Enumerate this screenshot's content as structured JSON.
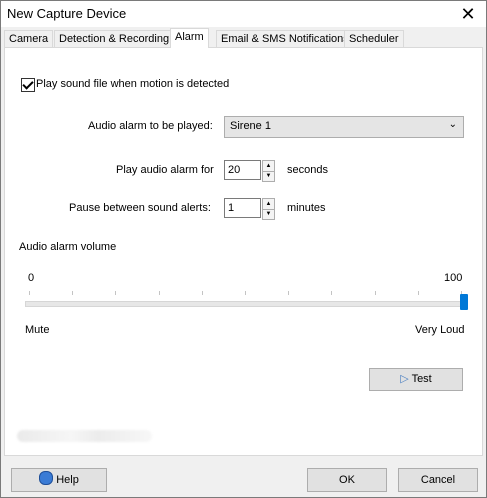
{
  "window": {
    "title": "New Capture Device"
  },
  "tabs": [
    {
      "label": "Camera"
    },
    {
      "label": "Detection & Recording"
    },
    {
      "label": "Alarm"
    },
    {
      "label": "Email & SMS Notifications"
    },
    {
      "label": "Scheduler"
    }
  ],
  "alarm": {
    "play_sound_label": "Play sound file when motion is detected",
    "play_sound_checked": true,
    "audio_alarm_label": "Audio alarm to be played:",
    "audio_alarm_value": "Sirene 1",
    "play_for_label": "Play audio alarm for",
    "play_for_value": "20",
    "play_for_unit": "seconds",
    "pause_label": "Pause between sound alerts:",
    "pause_value": "1",
    "pause_unit": "minutes",
    "volume_label": "Audio alarm volume",
    "volume_min": "0",
    "volume_max": "100",
    "volume_value": 100,
    "volume_low_label": "Mute",
    "volume_high_label": "Very Loud",
    "test_label": "Test"
  },
  "footer": {
    "help_label": "Help",
    "ok_label": "OK",
    "cancel_label": "Cancel"
  }
}
